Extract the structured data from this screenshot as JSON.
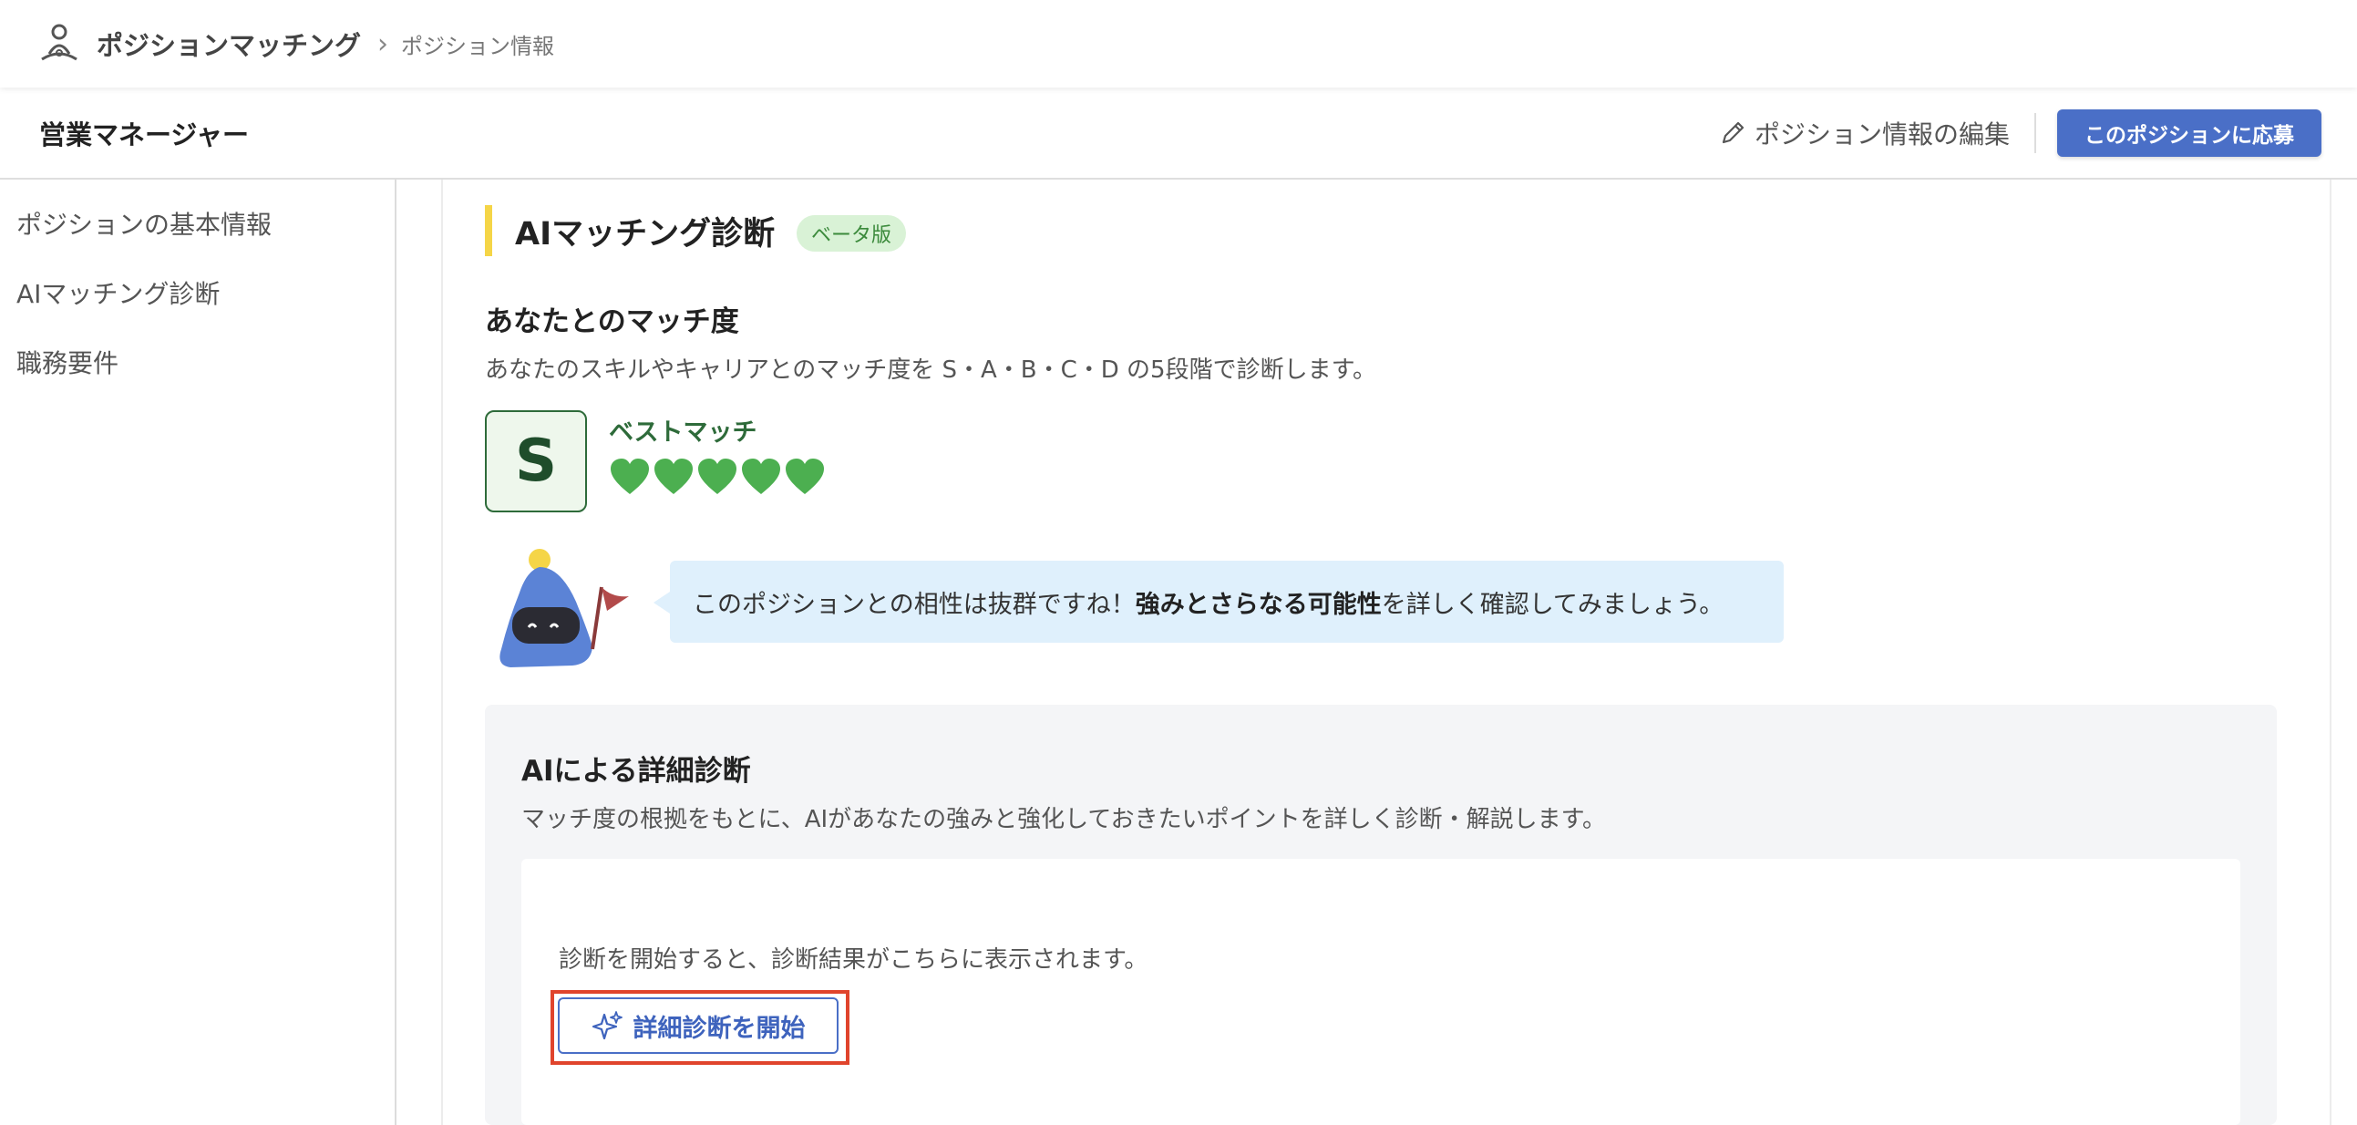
{
  "header": {
    "app_title": "ポジションマッチング",
    "breadcrumb_sep": "›",
    "breadcrumb_current": "ポジション情報"
  },
  "position": {
    "title": "営業マネージャー",
    "edit_label": "ポジション情報の編集",
    "apply_label": "このポジションに応募"
  },
  "sidebar": {
    "items": [
      {
        "label": "ポジションの基本情報"
      },
      {
        "label": "AIマッチング診断"
      },
      {
        "label": "職務要件"
      }
    ]
  },
  "ai_section": {
    "title": "AIマッチング診断",
    "badge": "ベータ版",
    "match_heading": "あなたとのマッチ度",
    "match_desc": "あなたのスキルやキャリアとのマッチ度を S・A・B・C・D の5段階で診断します。",
    "grade": "S",
    "grade_label": "ベストマッチ",
    "hearts": 5,
    "bubble_pre": "このポジションとの相性は抜群ですね！",
    "bubble_bold": "強みとさらなる可能性",
    "bubble_post": "を詳しく確認してみましょう。"
  },
  "detail": {
    "heading": "AIによる詳細診断",
    "desc": "マッチ度の根拠をもとに、AIがあなたの強みと強化しておきたいポイントを詳しく診断・解説します。",
    "placeholder_text": "診断を開始すると、診断結果がこちらに表示されます。",
    "start_label": "詳細診断を開始"
  },
  "colors": {
    "accent": "#4a6fc7",
    "heart": "#4caf50",
    "grade_border": "#2e6b3a",
    "highlight": "#e0442c"
  }
}
